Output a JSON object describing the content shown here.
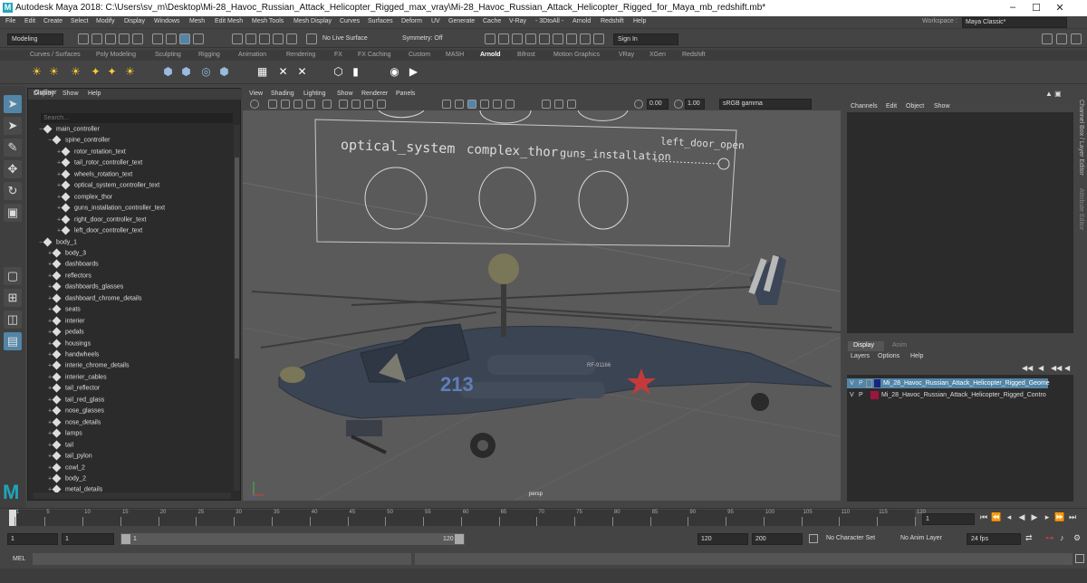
{
  "titlebar": {
    "title": "Autodesk Maya 2018: C:\\Users\\sv_m\\Desktop\\Mi-28_Havoc_Russian_Attack_Helicopter_Rigged_max_vray\\Mi-28_Havoc_Russian_Attack_Helicopter_Rigged_for_Maya_mb_redshift.mb*",
    "minimize": "–",
    "maximize": "☐",
    "close": "✕"
  },
  "menubar": {
    "items": [
      "File",
      "Edit",
      "Create",
      "Select",
      "Modify",
      "Display",
      "Windows",
      "Mesh",
      "Edit Mesh",
      "Mesh Tools",
      "Mesh Display",
      "Curves",
      "Surfaces",
      "Deform",
      "UV",
      "Generate",
      "Cache",
      "V-Ray",
      "- 3DtoAll -",
      "Arnold",
      "Redshift",
      "Help"
    ],
    "workspace_label": "Workspace :",
    "workspace_value": "Maya Classic*"
  },
  "statusline": {
    "mode": "Modeling",
    "live_surface": "No Live Surface",
    "symmetry": "Symmetry: Off",
    "sign_in": "Sign In"
  },
  "shelf_tabs": [
    "Curves / Surfaces",
    "Poly Modeling",
    "Sculpting",
    "Rigging",
    "Animation",
    "Rendering",
    "FX",
    "FX Caching",
    "Custom",
    "MASH",
    "Arnold",
    "Bifrost",
    "Motion Graphics",
    "VRay",
    "XGen",
    "Redshift"
  ],
  "active_shelf": "Arnold",
  "outliner": {
    "title": "Outliner",
    "menu": [
      "Display",
      "Show",
      "Help"
    ],
    "search_placeholder": "Search...",
    "rows": [
      "main_controller",
      "spine_controller",
      "rotor_rotation_text",
      "tail_rotor_controller_text",
      "wheels_rotation_text",
      "optical_system_controller_text",
      "complex_thor",
      "guns_installation_controller_text",
      "right_door_controller_text",
      "left_door_controller_text",
      "body_1",
      "body_3",
      "dashboards",
      "reflectors",
      "dashboards_glasses",
      "dashboard_chrome_details",
      "seats",
      "interier",
      "pedals",
      "housings",
      "handwheels",
      "interie_chrome_details",
      "interier_cables",
      "tail_reflector",
      "tail_red_glass",
      "nose_glasses",
      "nose_details",
      "lamps",
      "tail",
      "tail_pylon",
      "cowl_2",
      "body_2",
      "metal_details"
    ]
  },
  "viewport": {
    "menu": [
      "View",
      "Shading",
      "Lighting",
      "Show",
      "Renderer",
      "Panels"
    ],
    "exposure": "0.00",
    "gamma": "1.00",
    "color_space": "sRGB gamma",
    "camera": "persp",
    "labels": [
      "optical_system",
      "complex_thor",
      "guns_installation",
      "left_door_open"
    ],
    "fuselage_number": "213",
    "fuselage_text": "RF-91166"
  },
  "channel_box": {
    "menu": [
      "Channels",
      "Edit",
      "Object",
      "Show"
    ],
    "side_tabs": [
      "Channel Box / Layer Editor",
      "Attribute Editor"
    ]
  },
  "layer_editor": {
    "tabs": [
      "Display",
      "Anim"
    ],
    "menu": [
      "Layers",
      "Options",
      "Help"
    ],
    "layers": [
      {
        "v": "V",
        "p": "P",
        "color": "#1a237e",
        "name": "Mi_28_Havoc_Russian_Attack_Helicopter_Rigged_Geome",
        "selected": true
      },
      {
        "v": "V",
        "p": "P",
        "color": "#a0143c",
        "name": "Mi_28_Havoc_Russian_Attack_Helicopter_Rigged_Contro",
        "selected": false
      }
    ]
  },
  "timeslider": {
    "ticks": [
      "1",
      "5",
      "10",
      "15",
      "20",
      "25",
      "30",
      "35",
      "40",
      "45",
      "50",
      "55",
      "60",
      "65",
      "70",
      "75",
      "80",
      "85",
      "90",
      "95",
      "100",
      "105",
      "110",
      "115",
      "120"
    ],
    "current_frame": "1"
  },
  "range": {
    "start": "1",
    "start2": "1",
    "slider_start": "1",
    "slider_end": "120",
    "end": "120",
    "end2": "200",
    "character_set": "No Character Set",
    "anim_layer": "No Anim Layer",
    "fps": "24 fps"
  },
  "cmd": {
    "label": "MEL"
  }
}
